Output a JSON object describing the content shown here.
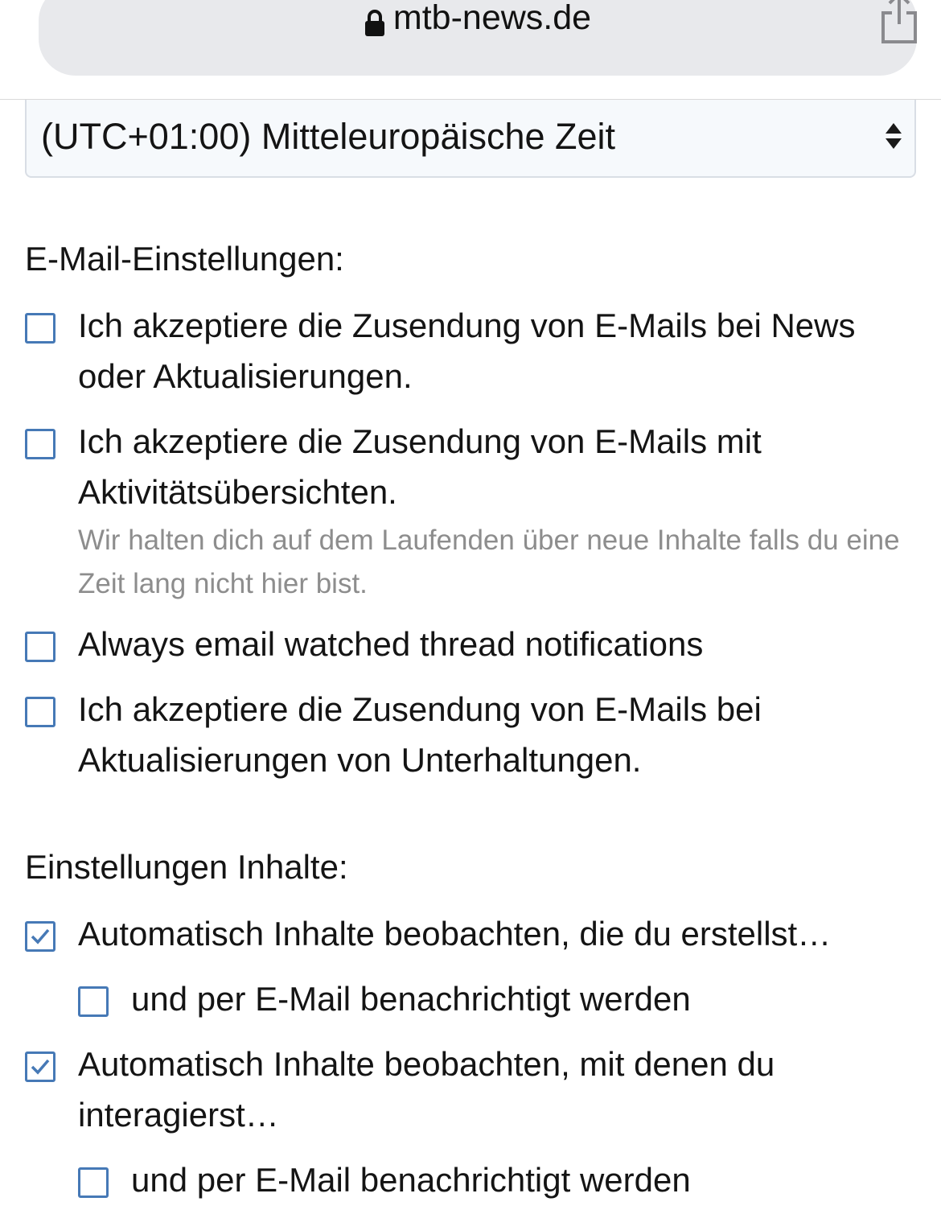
{
  "browser": {
    "url": "mtb-news.de",
    "lock_icon": "lock-icon",
    "share_icon": "share-icon"
  },
  "timezone_select": {
    "value": "(UTC+01:00) Mitteleuropäische Zeit"
  },
  "email_settings": {
    "heading": "E-Mail-Einstellungen:",
    "options": [
      {
        "label_line1": "Ich akzeptiere die Zusendung von E-Mails bei News",
        "label_line2": "oder Aktualisierungen.",
        "checked": false
      },
      {
        "label_line1": "Ich akzeptiere die Zusendung von E-Mails mit",
        "label_line2": "Aktivitätsübersichten.",
        "hint": "Wir halten dich auf dem Laufenden über neue Inhalte falls du eine Zeit lang nicht hier bist.",
        "checked": false
      },
      {
        "label_line1": "Always email watched thread notifications",
        "checked": false
      },
      {
        "label_line1": "Ich akzeptiere die Zusendung von E-Mails bei",
        "label_line2": "Aktualisierungen von Unterhaltungen.",
        "checked": false
      }
    ]
  },
  "content_settings": {
    "heading": "Einstellungen Inhalte:",
    "options": [
      {
        "label_line1": "Automatisch Inhalte beobachten, die du erstellst…",
        "checked": true,
        "sub": {
          "label": "und per E-Mail benachrichtigt werden",
          "checked": false
        }
      },
      {
        "label_line1": "Automatisch Inhalte beobachten, mit denen du",
        "label_line2": "interagierst…",
        "checked": true,
        "sub": {
          "label": "und per E-Mail benachrichtigt werden",
          "checked": false
        }
      }
    ]
  },
  "colors": {
    "checkbox_border": "#4679b6",
    "urlbar_bg": "#e8e9ec",
    "hint_text": "#8d8d8d"
  }
}
